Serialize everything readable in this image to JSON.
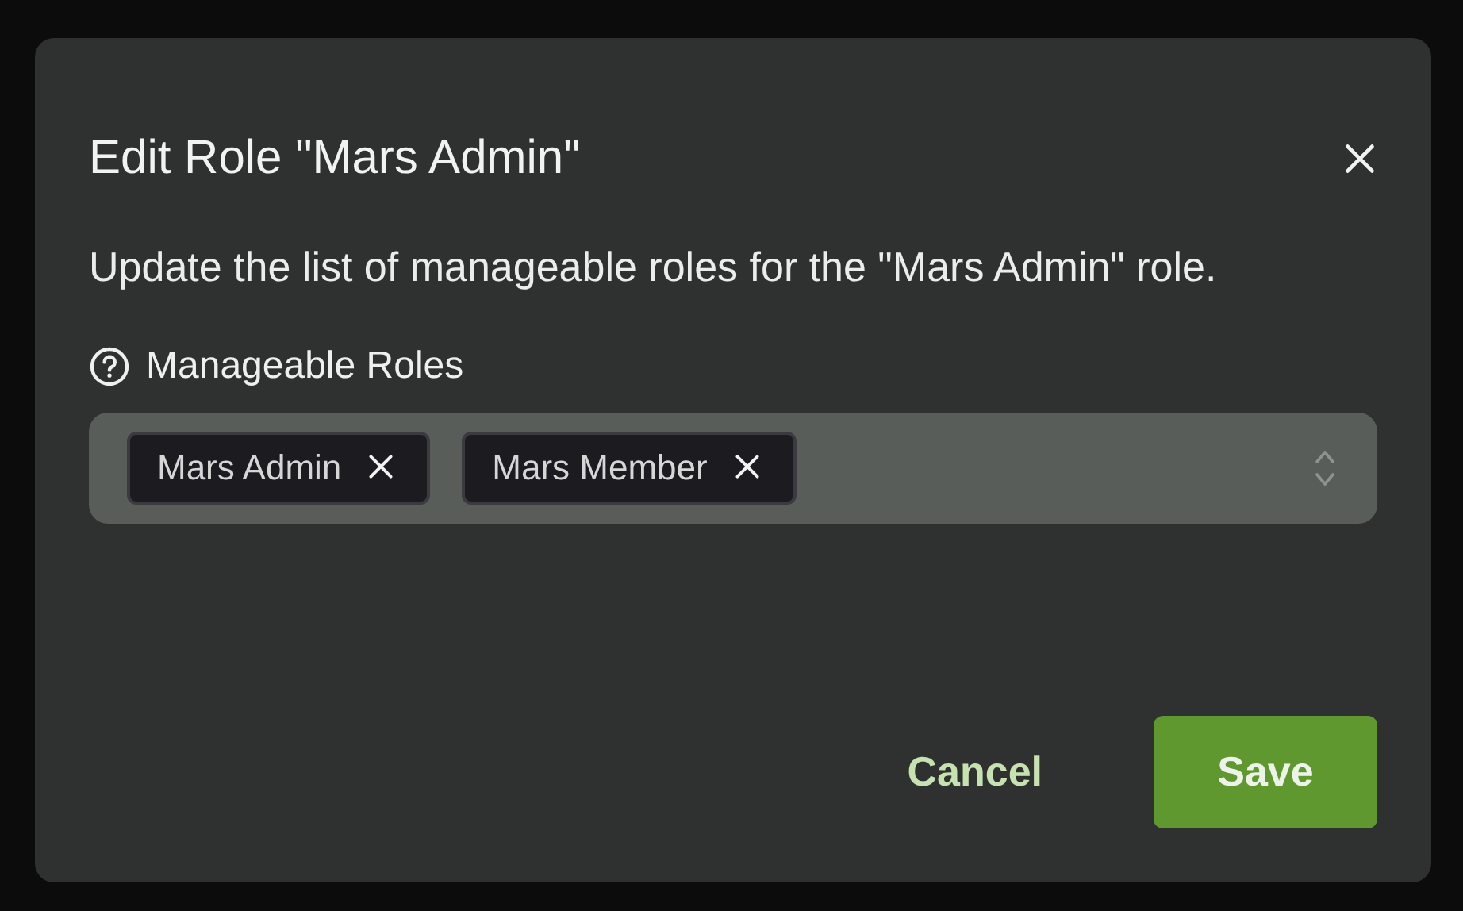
{
  "dialog": {
    "title": "Edit Role \"Mars Admin\"",
    "description": "Update the list of manageable roles for the \"Mars Admin\" role.",
    "field": {
      "label": "Manageable Roles",
      "chips": [
        {
          "label": "Mars Admin"
        },
        {
          "label": "Mars Member"
        }
      ]
    },
    "buttons": [
      {
        "label": "Cancel",
        "kind": "secondary"
      },
      {
        "label": "Save",
        "kind": "primary"
      }
    ]
  }
}
